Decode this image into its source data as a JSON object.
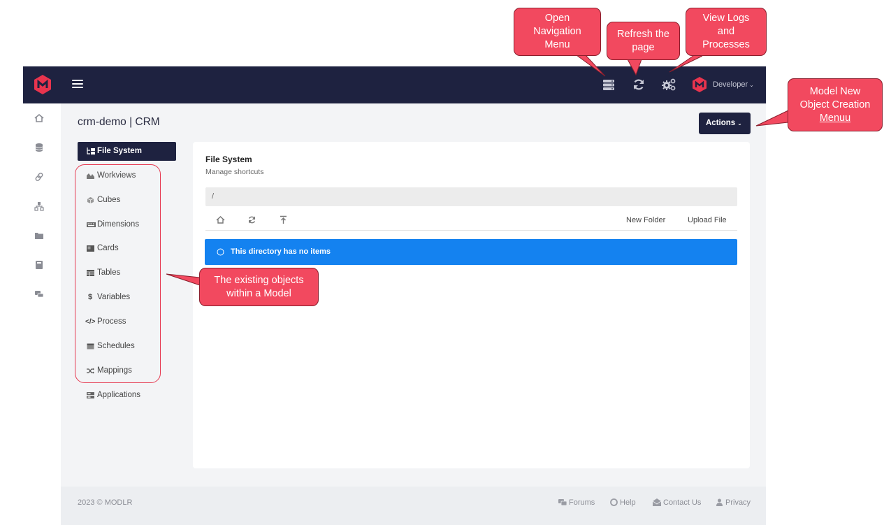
{
  "header": {
    "user_name": "Developer",
    "icons": [
      "navigation-menu-icon",
      "refresh-icon",
      "logs-processes-icon"
    ],
    "brand_color": "#1e2240",
    "logo_color": "#e8344e"
  },
  "rail": {
    "icons": [
      "home-icon",
      "database-icon",
      "link-icon",
      "hierarchy-icon",
      "folder-icon",
      "book-icon",
      "chat-icon"
    ]
  },
  "page": {
    "title": "crm-demo | CRM",
    "actions_label": "Actions"
  },
  "nav": {
    "items": [
      {
        "label": "File System",
        "icon": "file-system-icon",
        "active": true
      },
      {
        "label": "Workviews",
        "icon": "workviews-icon"
      },
      {
        "label": "Cubes",
        "icon": "cube-icon"
      },
      {
        "label": "Dimensions",
        "icon": "dimensions-icon"
      },
      {
        "label": "Cards",
        "icon": "card-icon"
      },
      {
        "label": "Tables",
        "icon": "table-icon"
      },
      {
        "label": "Variables",
        "icon": "dollar-icon"
      },
      {
        "label": "Process",
        "icon": "code-icon"
      },
      {
        "label": "Schedules",
        "icon": "calendar-icon"
      },
      {
        "label": "Mappings",
        "icon": "shuffle-icon"
      },
      {
        "label": "Applications",
        "icon": "applications-icon"
      }
    ]
  },
  "content": {
    "title": "File System",
    "subtitle": "Manage shortcuts",
    "path": "/",
    "toolbar": {
      "icons": [
        "home-icon",
        "refresh-icon",
        "upload-arrow-icon"
      ],
      "new_folder": "New Folder",
      "upload_file": "Upload File"
    },
    "empty_message": "This directory has no items",
    "alert_color": "#1482f0"
  },
  "footer": {
    "copyright": "2023 © MODLR",
    "links": [
      {
        "label": "Forums",
        "icon": "forums-icon"
      },
      {
        "label": "Help",
        "icon": "help-icon"
      },
      {
        "label": "Contact Us",
        "icon": "contact-icon"
      },
      {
        "label": "Privacy",
        "icon": "privacy-icon"
      }
    ]
  },
  "callouts": {
    "open_nav": [
      "Open",
      "Navigation",
      "Menu"
    ],
    "refresh": [
      "Refresh the",
      "page"
    ],
    "view_logs": [
      "View Logs",
      "and",
      "Processes"
    ],
    "model_new": [
      "Model New",
      "Object Creation",
      "Menuu"
    ],
    "existing_objects": [
      "The existing objects",
      "within a Model"
    ],
    "color": "#f2495f"
  }
}
